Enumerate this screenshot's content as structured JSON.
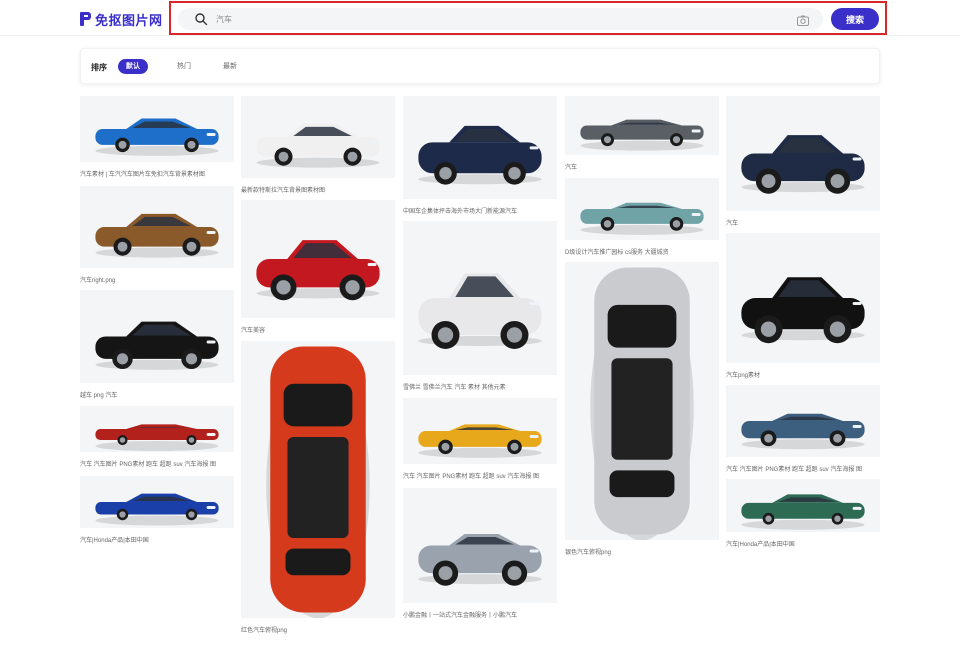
{
  "header": {
    "logo_text": "免抠图片网",
    "search_value": "汽车",
    "search_button": "搜索"
  },
  "sort": {
    "label": "排序",
    "options": [
      "默认",
      "热门",
      "最新"
    ],
    "active": 0
  },
  "colors": {
    "accent": "#3b2fc9",
    "highlight_border": "#d9262b",
    "thumb_bg": "#f4f5f7"
  },
  "cards": [
    {
      "caption": "汽车素材 | 车汽汽车图片车免扣汽车背景素材图",
      "color": "#1e6fc9",
      "kind": "side"
    },
    {
      "caption": "汽车right.png",
      "color": "#8a5a2b",
      "kind": "side"
    },
    {
      "caption": "越车 png 汽车",
      "color": "#151515",
      "kind": "front"
    },
    {
      "caption": "汽车 汽车图片 PNG素材 跑车 超跑 suv 汽车海报 图",
      "color": "#b3211c",
      "kind": "sport"
    },
    {
      "caption": "汽车|Honda产品|本田中国",
      "color": "#1b3fa8",
      "kind": "side"
    },
    {
      "caption": "最新款特斯拉汽车背景图素材图",
      "color": "#f0f0f0",
      "kind": "side"
    },
    {
      "caption": "汽车美容",
      "color": "#c41820",
      "kind": "side"
    },
    {
      "caption": "红色汽车俯视png",
      "color": "#d63a1c",
      "kind": "top"
    },
    {
      "caption": "中国车企集体抨击海外市场大门新能源汽车",
      "color": "#1d2a4a",
      "kind": "suv"
    },
    {
      "caption": "雪佛兰 雪佛兰汽车 汽车 素材 其他元素",
      "color": "#e8e8ea",
      "kind": "side"
    },
    {
      "caption": "汽车 汽车图片 PNG素材 跑车 超跑 suv 汽车海报 图",
      "color": "#e7a81c",
      "kind": "sport"
    },
    {
      "caption": "小鹏金融丨一站式汽车金融服务丨小鹏汽车",
      "color": "#9aa3ad",
      "kind": "sport"
    },
    {
      "caption": "汽车",
      "color": "#5a5f66",
      "kind": "sport"
    },
    {
      "caption": "D级设计汽车推广园标 cs服务 大疆城资",
      "color": "#6fa3a6",
      "kind": "sport"
    },
    {
      "caption": "银色汽车俯视png",
      "color": "#c9cbcf",
      "kind": "top"
    },
    {
      "caption": "汽车",
      "color": "#1f2a44",
      "kind": "side"
    },
    {
      "caption": "汽车png素材",
      "color": "#111111",
      "kind": "side"
    },
    {
      "caption": "汽车 汽车图片 PNG素材 跑车 超跑 suv 汽车海报 图",
      "color": "#3d5f7f",
      "kind": "sport"
    },
    {
      "caption": "汽车|Honda产品|本田中国",
      "color": "#2e6b55",
      "kind": "suv"
    }
  ]
}
